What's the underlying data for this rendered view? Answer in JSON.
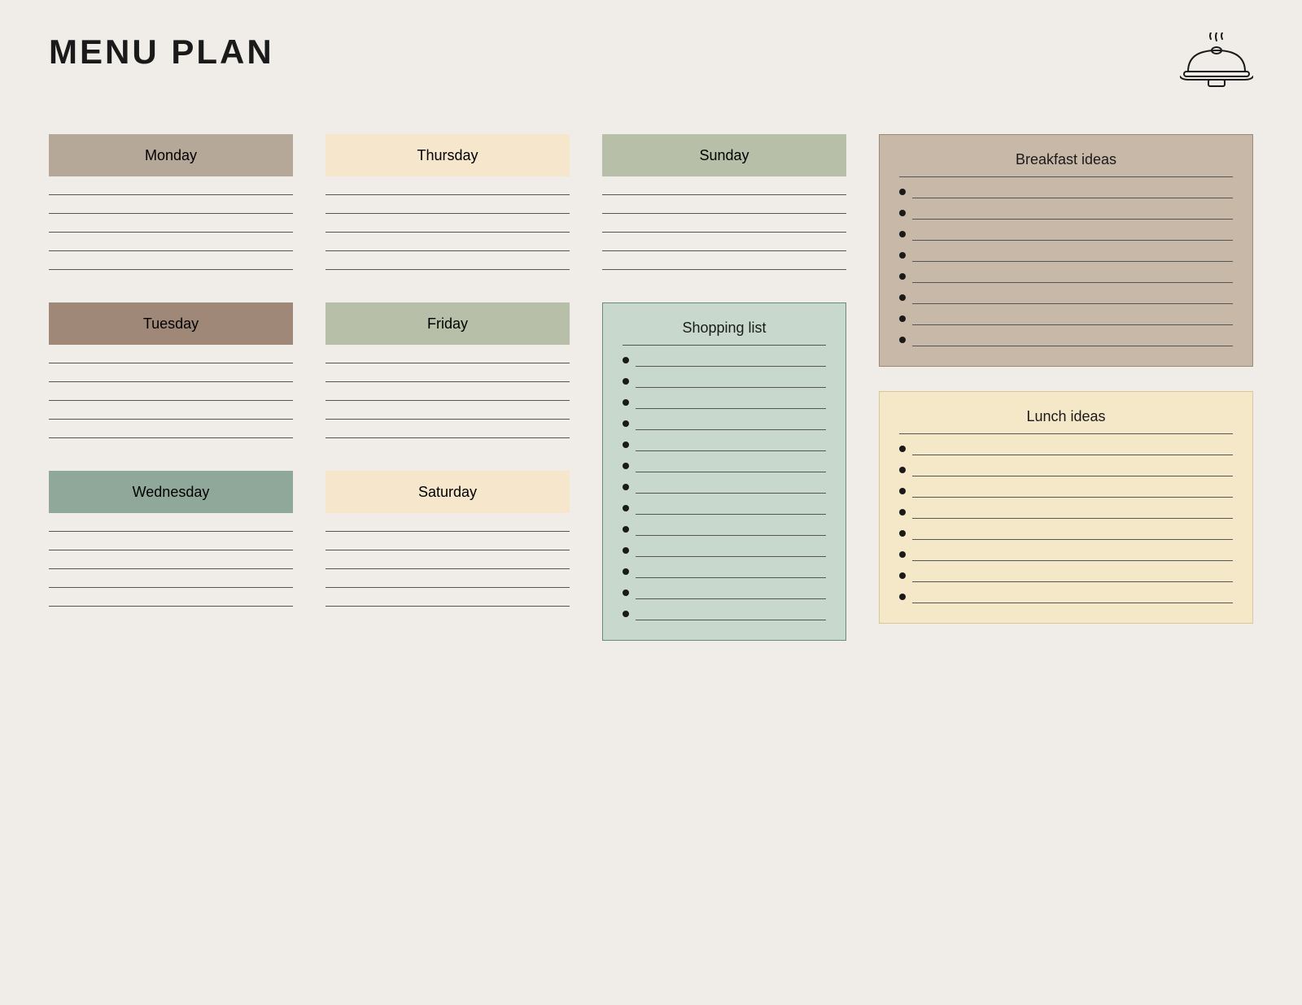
{
  "header": {
    "title": "MENU PLAN"
  },
  "days": {
    "monday": {
      "label": "Monday",
      "colorClass": "monday-label",
      "lineCount": 5
    },
    "tuesday": {
      "label": "Tuesday",
      "colorClass": "tuesday-label",
      "lineCount": 5
    },
    "wednesday": {
      "label": "Wednesday",
      "colorClass": "wednesday-label",
      "lineCount": 5
    },
    "thursday": {
      "label": "Thursday",
      "colorClass": "thursday-label",
      "lineCount": 5
    },
    "friday": {
      "label": "Friday",
      "colorClass": "friday-label",
      "lineCount": 5
    },
    "saturday": {
      "label": "Saturday",
      "colorClass": "saturday-label",
      "lineCount": 5
    },
    "sunday": {
      "label": "Sunday",
      "colorClass": "sunday-label",
      "lineCount": 5
    }
  },
  "shopping_list": {
    "title": "Shopping list",
    "itemCount": 13
  },
  "breakfast_ideas": {
    "title": "Breakfast ideas",
    "itemCount": 8
  },
  "lunch_ideas": {
    "title": "Lunch ideas",
    "itemCount": 8
  }
}
